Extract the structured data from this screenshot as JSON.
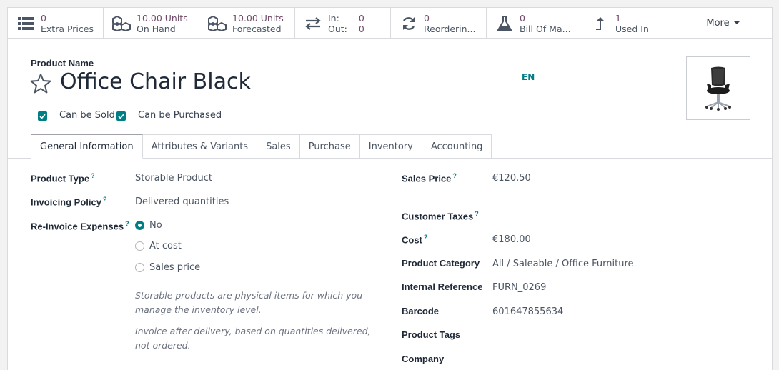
{
  "smart_buttons": [
    {
      "value": "0",
      "label": "Extra Prices",
      "icon": "list-icon"
    },
    {
      "value": "10.00 Units",
      "label": "On Hand",
      "icon": "cubes-icon"
    },
    {
      "value": "10.00 Units",
      "label": "Forecasted",
      "icon": "cubes-icon"
    },
    {
      "in_label": "In:",
      "in_value": "0",
      "out_label": "Out:",
      "out_value": "0",
      "icon": "exchange-icon"
    },
    {
      "value": "0",
      "label": "Reorderin...",
      "icon": "refresh-icon"
    },
    {
      "value": "0",
      "label": "Bill Of Ma...",
      "icon": "flask-icon"
    },
    {
      "value": "1",
      "label": "Used In",
      "icon": "level-up-icon"
    }
  ],
  "more_label": "More",
  "product": {
    "name_label": "Product Name",
    "name": "Office Chair Black",
    "lang": "EN",
    "can_be_sold": "Can be Sold",
    "can_be_purchased": "Can be Purchased"
  },
  "tabs": [
    "General Information",
    "Attributes & Variants",
    "Sales",
    "Purchase",
    "Inventory",
    "Accounting"
  ],
  "left_fields": {
    "product_type_label": "Product Type",
    "product_type": "Storable Product",
    "invoicing_policy_label": "Invoicing Policy",
    "invoicing_policy": "Delivered quantities",
    "reinvoice_label": "Re-Invoice Expenses",
    "reinvoice_options": [
      "No",
      "At cost",
      "Sales price"
    ],
    "help_1": "Storable products are physical items for which you manage the inventory level.",
    "help_2": "Invoice after delivery, based on quantities delivered, not ordered."
  },
  "right_fields": {
    "sales_price_label": "Sales Price",
    "sales_price": "€120.50",
    "customer_taxes_label": "Customer Taxes",
    "cost_label": "Cost",
    "cost": "€180.00",
    "category_label": "Product Category",
    "category": "All / Saleable / Office Furniture",
    "internal_ref_label": "Internal Reference",
    "internal_ref": "FURN_0269",
    "barcode_label": "Barcode",
    "barcode": "601647855634",
    "tags_label": "Product Tags",
    "company_label": "Company"
  },
  "help_mark": "?",
  "colors": {
    "accent": "#017e84",
    "brand": "#714b67"
  }
}
